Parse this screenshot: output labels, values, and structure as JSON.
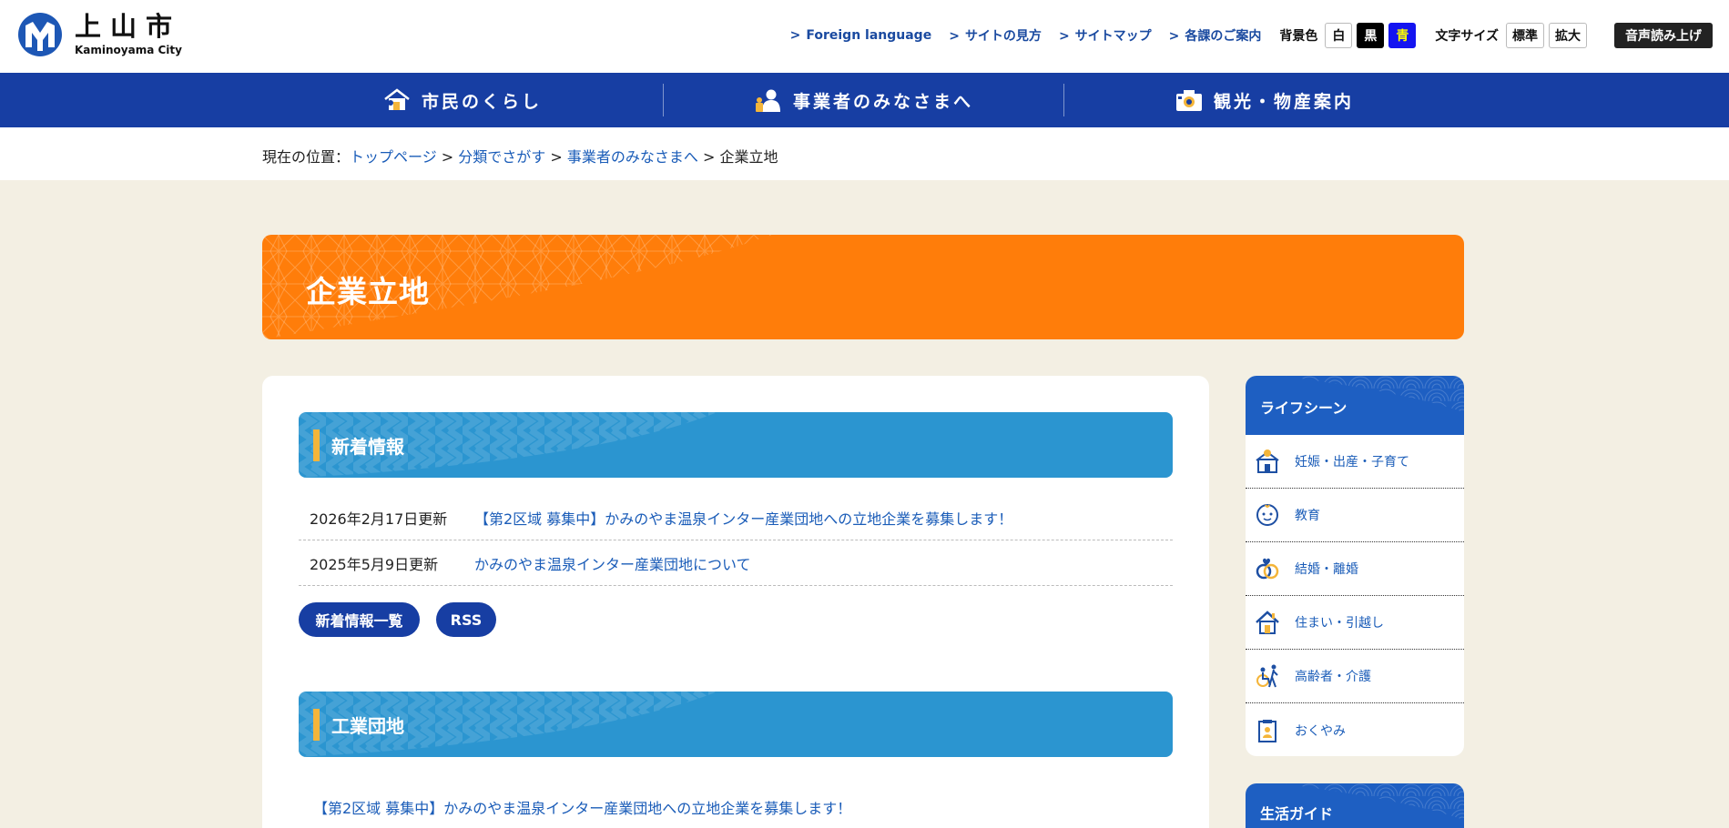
{
  "header": {
    "logo_ja": "上山市",
    "logo_en": "Kaminoyama City",
    "util_links": [
      {
        "label": "Foreign language"
      },
      {
        "label": "サイトの見方"
      },
      {
        "label": "サイトマップ"
      },
      {
        "label": "各課のご案内"
      }
    ],
    "link_arrow": ">",
    "bg_color_label": "背景色",
    "bg_white": "白",
    "bg_black": "黒",
    "bg_blue": "青",
    "font_size_label": "文字サイズ",
    "font_standard": "標準",
    "font_large": "拡大",
    "voice_label": "音声読み上げ"
  },
  "gnav": {
    "items": [
      {
        "label": "市民のくらし",
        "icon": "house-icon"
      },
      {
        "label": "事業者のみなさまへ",
        "icon": "business-person-icon"
      },
      {
        "label": "観光・物産案内",
        "icon": "camera-icon"
      }
    ]
  },
  "breadcrumb": {
    "prefix": "現在の位置：",
    "items": [
      "トップページ",
      "分類でさがす",
      "事業者のみなさまへ"
    ],
    "sep": " > ",
    "current": "企業立地"
  },
  "page_title": "企業立地",
  "news": {
    "heading": "新着情報",
    "items": [
      {
        "date": "2026年2月17日更新",
        "title": "【第2区域 募集中】かみのやま温泉インター産業団地への立地企業を募集します！"
      },
      {
        "date": "2025年5月9日更新",
        "title": "かみのやま温泉インター産業団地について"
      }
    ],
    "list_button": "新着情報一覧",
    "rss_button": "RSS"
  },
  "industrial": {
    "heading": "工業団地",
    "link": "【第2区域 募集中】かみのやま温泉インター産業団地への立地企業を募集します！"
  },
  "side_menu": {
    "heading": "ライフシーン",
    "items": [
      {
        "label": "妊娠・出産・子育て",
        "icon": "maternity-icon"
      },
      {
        "label": "教育",
        "icon": "baby-face-icon"
      },
      {
        "label": "結婚・離婚",
        "icon": "rings-icon"
      },
      {
        "label": "住まい・引越し",
        "icon": "home-icon"
      },
      {
        "label": "高齢者・介護",
        "icon": "wheelchair-icon"
      },
      {
        "label": "おくやみ",
        "icon": "memorial-icon"
      }
    ]
  },
  "side_menu2": {
    "heading": "生活ガイド"
  },
  "colors": {
    "nav_blue": "#173ea3",
    "title_orange": "#ff7d0a",
    "section_blue": "#2b95d0",
    "accent_yellow": "#f4b53a",
    "link_blue": "#1a5cb8",
    "page_bg": "#f3efe3"
  }
}
